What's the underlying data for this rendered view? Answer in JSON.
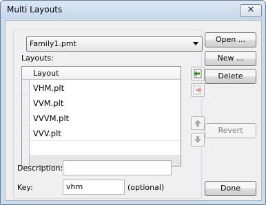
{
  "window": {
    "title": "Multi Layouts",
    "close_glyph": "✕"
  },
  "family_combo": {
    "value": "Family1.pmt"
  },
  "layouts_label": "Layouts:",
  "grid": {
    "header": "Layout",
    "rows": [
      {
        "label": "VHM.plt"
      },
      {
        "label": "VVM.plt"
      },
      {
        "label": "VVVM.plt"
      },
      {
        "label": "VVV.plt"
      }
    ]
  },
  "description": {
    "label": "Description:",
    "value": ""
  },
  "key": {
    "label": "Key:",
    "value": "vhm",
    "note": "(optional)"
  },
  "buttons": {
    "open": "Open ...",
    "new": "New ...",
    "delete": "Delete",
    "revert": "Revert",
    "done": "Done"
  },
  "colors": {
    "add_icon": "#3f8f2f",
    "remove_icon": "#d04848",
    "arrow_icon_disabled": "#a8a8a8"
  }
}
